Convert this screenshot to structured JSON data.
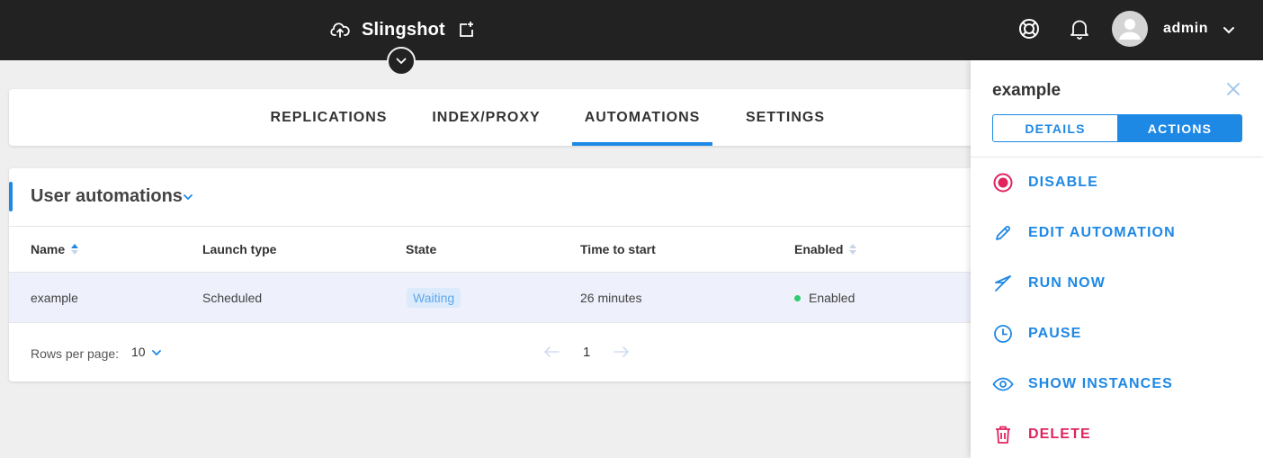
{
  "header": {
    "app_name": "Slingshot",
    "username": "admin"
  },
  "tabs": [
    {
      "label": "REPLICATIONS"
    },
    {
      "label": "INDEX/PROXY"
    },
    {
      "label": "AUTOMATIONS",
      "active": true
    },
    {
      "label": "SETTINGS"
    }
  ],
  "card": {
    "title": "User automations",
    "columns": [
      "Name",
      "Launch type",
      "State",
      "Time to start",
      "Enabled"
    ],
    "rows": [
      {
        "name": "example",
        "launch_type": "Scheduled",
        "state": "Waiting",
        "time_to_start": "26 minutes",
        "enabled": "Enabled"
      }
    ],
    "footer": {
      "rows_per_page_label": "Rows per page:",
      "rows_per_page_value": "10",
      "page": "1"
    }
  },
  "panel": {
    "title": "example",
    "tabs": {
      "details": "DETAILS",
      "actions": "ACTIONS"
    },
    "actions": [
      {
        "label": "DISABLE",
        "icon": "record-icon",
        "color": "#e0245e"
      },
      {
        "label": "EDIT AUTOMATION",
        "icon": "pencil-icon",
        "color": "#1e88e5"
      },
      {
        "label": "RUN NOW",
        "icon": "run-icon",
        "color": "#1e88e5"
      },
      {
        "label": "PAUSE",
        "icon": "clock-icon",
        "color": "#1e88e5"
      },
      {
        "label": "SHOW INSTANCES",
        "icon": "eye-icon",
        "color": "#1e88e5"
      },
      {
        "label": "DELETE",
        "icon": "trash-icon",
        "color": "#e0245e"
      }
    ]
  },
  "colors": {
    "accent": "#1e88e5",
    "danger": "#e0245e",
    "topbar": "#222222",
    "enabled_dot": "#2ecc71"
  }
}
